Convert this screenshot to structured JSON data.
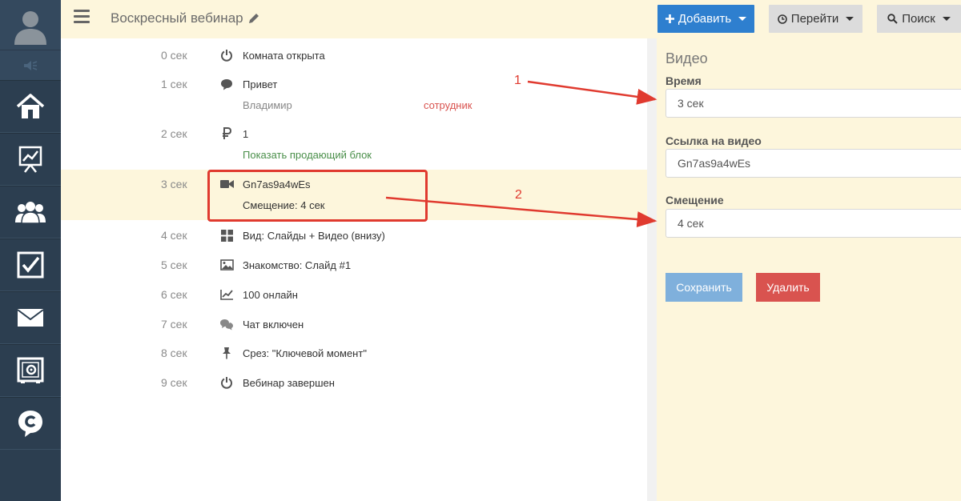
{
  "header": {
    "title": "Воскресный вебинар",
    "add_label": "Добавить",
    "go_label": "Перейти",
    "search_label": "Поиск"
  },
  "sidebar": {
    "items": [
      {
        "icon": "home-icon"
      },
      {
        "icon": "chart-icon"
      },
      {
        "icon": "users-icon"
      },
      {
        "icon": "checkbox-icon"
      },
      {
        "icon": "mail-icon"
      },
      {
        "icon": "safe-icon"
      },
      {
        "icon": "chat-c-icon"
      }
    ]
  },
  "timeline": [
    {
      "time": "0 сек",
      "icon": "power-icon",
      "text": "Комната открыта",
      "style": "green"
    },
    {
      "time": "1 сек",
      "icon": "comment-icon",
      "text": "Привет",
      "sub_left": "Владимир",
      "sub_right": "сотрудник"
    },
    {
      "time": "2 сек",
      "icon": "ruble-icon",
      "text": "1",
      "sub": "Показать продающий блок"
    },
    {
      "time": "3 сек",
      "icon": "video-icon",
      "text": "Gn7as9a4wEs",
      "sub": "Смещение: 4 сек"
    },
    {
      "time": "4 сек",
      "icon": "grid-icon",
      "text": "Вид: Слайды + Видео (внизу)"
    },
    {
      "time": "5 сек",
      "icon": "image-icon",
      "text": "Знакомство: Слайд #1"
    },
    {
      "time": "6 сек",
      "icon": "line-chart-icon",
      "text": "100 онлайн"
    },
    {
      "time": "7 сек",
      "icon": "comments-icon",
      "text": "Чат включен",
      "style": "green"
    },
    {
      "time": "8 сек",
      "icon": "pin-icon",
      "text": "Срез: \"Ключевой момент\""
    },
    {
      "time": "9 сек",
      "icon": "power-icon",
      "text": "Вебинар завершен",
      "style": "red"
    }
  ],
  "panel": {
    "title": "Видео",
    "time_label": "Время",
    "time_value": "3 сек",
    "link_label": "Ссылка на видео",
    "link_value": "Gn7as9a4wEs",
    "offset_label": "Смещение",
    "offset_value": "4 сек",
    "save_label": "Сохранить",
    "delete_label": "Удалить"
  },
  "annotations": {
    "one": "1",
    "two": "2"
  },
  "colors": {
    "accent": "#2e7fcf",
    "danger": "#d9534f",
    "highlight": "#fdf6dc",
    "sidebar": "#2c3e50",
    "annotation": "#e03a2f"
  }
}
